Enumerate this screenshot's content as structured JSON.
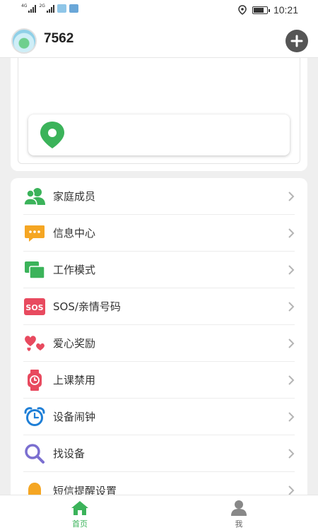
{
  "status_bar": {
    "network_1": "4G",
    "network_2": "2G",
    "time": "10:21"
  },
  "header": {
    "device_name": "7562",
    "add_icon": "plus-circle-icon"
  },
  "location": {
    "pin_icon": "location-pin-icon",
    "address": ""
  },
  "menu": {
    "items": [
      {
        "label": "家庭成员",
        "icon": "family-members-icon"
      },
      {
        "label": "信息中心",
        "icon": "message-center-icon"
      },
      {
        "label": "工作模式",
        "icon": "work-mode-icon"
      },
      {
        "label": "SOS/亲情号码",
        "icon": "sos-icon"
      },
      {
        "label": "爱心奖励",
        "icon": "hearts-icon"
      },
      {
        "label": "上课禁用",
        "icon": "class-disable-watch-icon"
      },
      {
        "label": "设备闹钟",
        "icon": "alarm-clock-icon"
      },
      {
        "label": "找设备",
        "icon": "search-device-icon"
      },
      {
        "label": "短信提醒设置",
        "icon": "sms-reminder-bell-icon"
      }
    ]
  },
  "bottom_nav": {
    "home_label": "首页",
    "me_label": "我"
  },
  "colors": {
    "accent_green": "#3bb35a",
    "sos_red": "#e84a5f",
    "message_orange": "#f5a623",
    "alarm_blue": "#1f7fd6",
    "search_purple": "#7b6fd0"
  }
}
